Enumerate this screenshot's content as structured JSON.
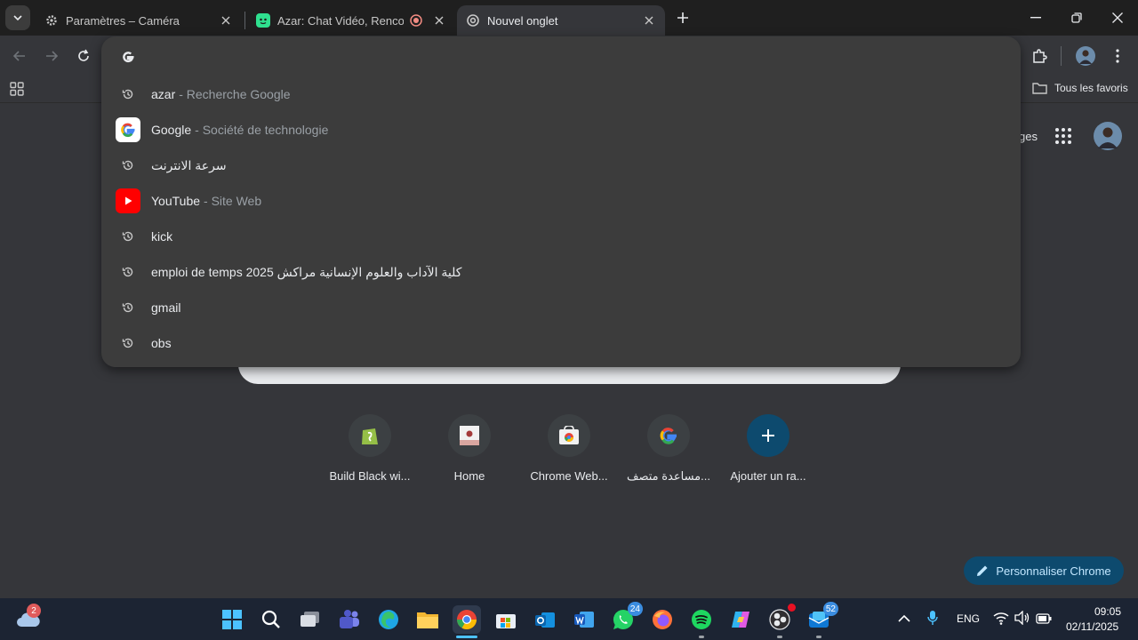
{
  "tabs": [
    {
      "title": "Paramètres – Caméra",
      "icon": "gear-icon"
    },
    {
      "title": "Azar: Chat Vidéo, Rencontres",
      "icon": "azar-icon",
      "recording": true
    },
    {
      "title": "Nouvel onglet",
      "icon": "chrome-icon",
      "active": true
    }
  ],
  "omnibox": {
    "input_value": "",
    "suggestions": [
      {
        "main": "azar",
        "desc": "- Recherche Google",
        "icon": "history-icon"
      },
      {
        "main": "Google",
        "desc": "- Société de technologie",
        "icon": "google-icon"
      },
      {
        "main": "سرعة الانترنت",
        "desc": "",
        "icon": "history-icon"
      },
      {
        "main": "YouTube",
        "desc": "- Site Web",
        "icon": "youtube-icon"
      },
      {
        "main": "kick",
        "desc": "",
        "icon": "history-icon"
      },
      {
        "main": "emploi de temps 2025 كلية الآداب والعلوم الإنسانية مراكش",
        "desc": "",
        "icon": "history-icon"
      },
      {
        "main": "gmail",
        "desc": "",
        "icon": "history-icon"
      },
      {
        "main": "obs",
        "desc": "",
        "icon": "history-icon"
      }
    ]
  },
  "bookmarks": {
    "all_favorites": "Tous les favoris"
  },
  "header": {
    "images_partial": "ges"
  },
  "shortcuts": [
    {
      "label": "Build Black wi...",
      "icon": "shopify-icon"
    },
    {
      "label": "Home",
      "icon": "home-page-icon"
    },
    {
      "label": "Chrome Web...",
      "icon": "chrome-web-store-icon"
    },
    {
      "label": "مساعدة متصف...",
      "icon": "google-icon"
    },
    {
      "label": "Ajouter un ra...",
      "icon": "plus-icon"
    }
  ],
  "customize_button": "Personnaliser Chrome",
  "taskbar": {
    "weather_badge": "2",
    "whatsapp_badge": "24",
    "outlook_badge": "52",
    "language": "ENG",
    "time": "09:05",
    "date": "02/11/2025"
  },
  "colors": {
    "accent": "#0d4a6e",
    "tab_bg": "#1f1f1f",
    "page_bg": "#35363a",
    "dropdown_bg": "#3c3c3c"
  }
}
